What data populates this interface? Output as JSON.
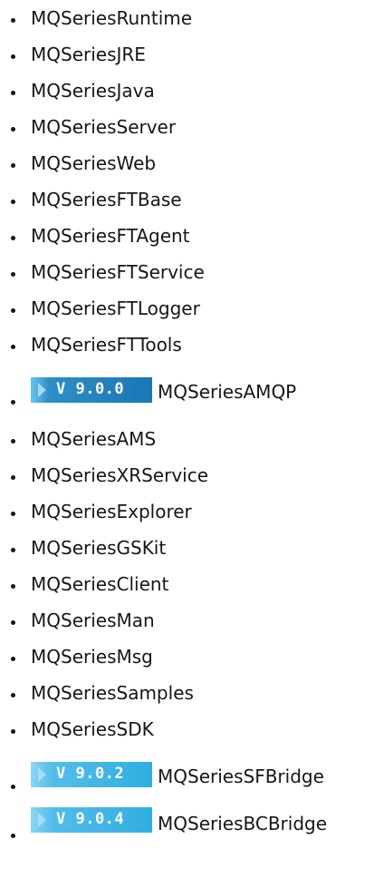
{
  "packages": [
    {
      "name": "MQSeriesRuntime"
    },
    {
      "name": "MQSeriesJRE"
    },
    {
      "name": "MQSeriesJava"
    },
    {
      "name": "MQSeriesServer"
    },
    {
      "name": "MQSeriesWeb"
    },
    {
      "name": "MQSeriesFTBase"
    },
    {
      "name": "MQSeriesFTAgent"
    },
    {
      "name": "MQSeriesFTService"
    },
    {
      "name": "MQSeriesFTLogger"
    },
    {
      "name": "MQSeriesFTTools"
    },
    {
      "name": "MQSeriesAMQP",
      "version": "V 9.0.0",
      "badge_color": "#1a76b4"
    },
    {
      "name": "MQSeriesAMS"
    },
    {
      "name": "MQSeriesXRService"
    },
    {
      "name": "MQSeriesExplorer"
    },
    {
      "name": "MQSeriesGSKit"
    },
    {
      "name": "MQSeriesClient"
    },
    {
      "name": "MQSeriesMan"
    },
    {
      "name": "MQSeriesMsg"
    },
    {
      "name": "MQSeriesSamples"
    },
    {
      "name": "MQSeriesSDK"
    },
    {
      "name": "MQSeriesSFBridge",
      "version": "V 9.0.2",
      "badge_color": "#30aee2"
    },
    {
      "name": "MQSeriesBCBridge",
      "version": "V 9.0.4",
      "badge_color": "#30aee2"
    }
  ]
}
